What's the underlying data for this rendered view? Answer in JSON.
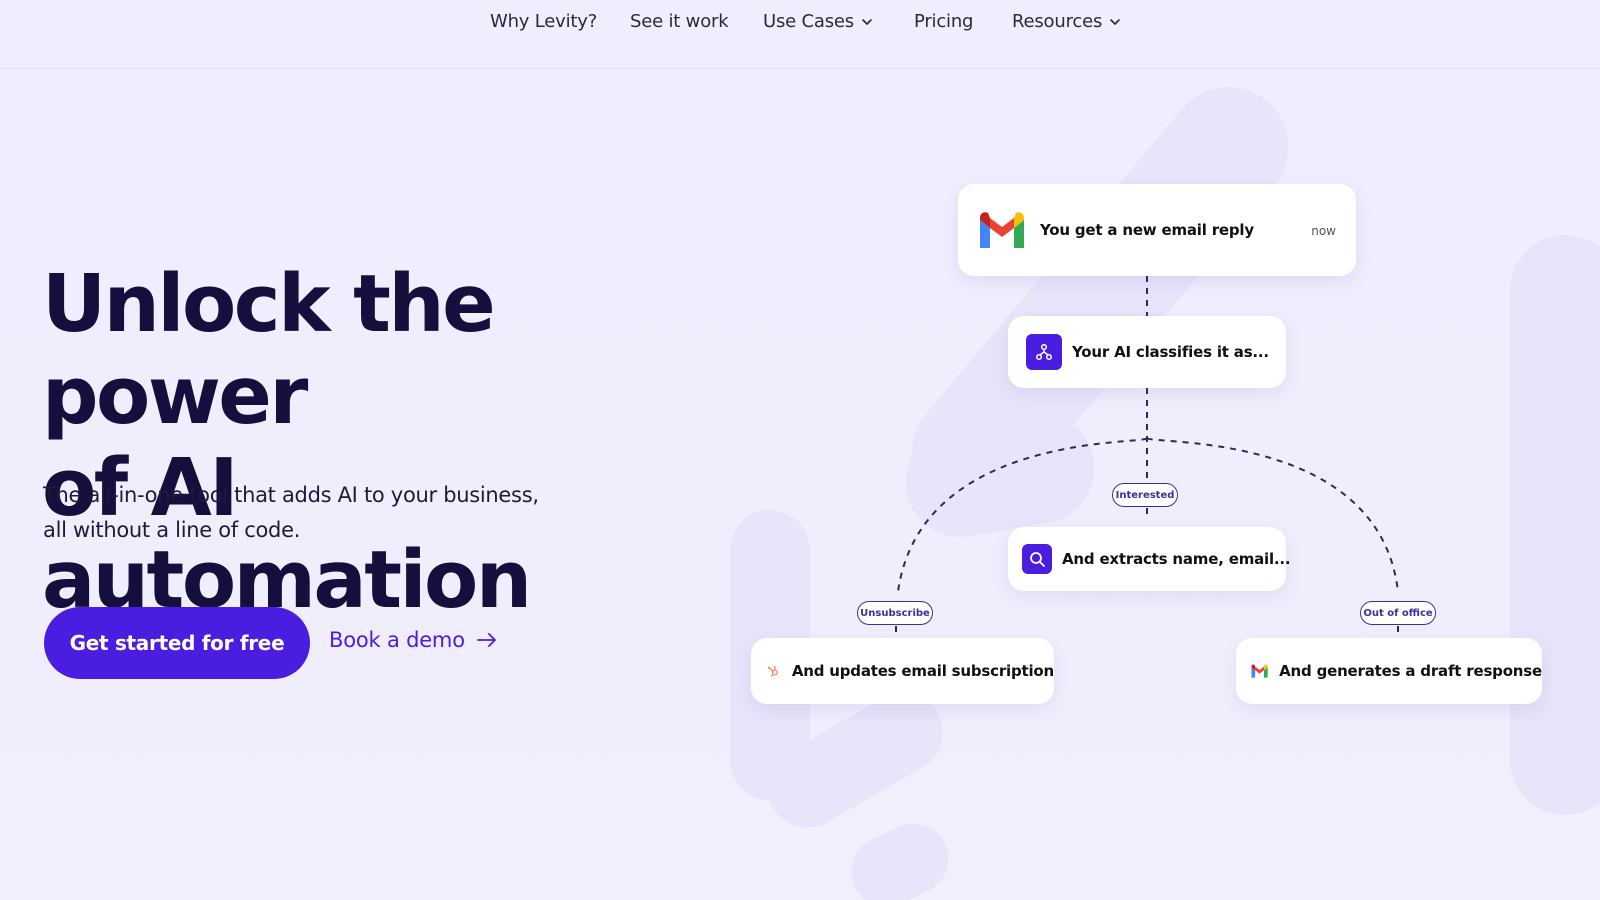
{
  "nav": {
    "items": [
      {
        "label": "Why Levity?",
        "has_dropdown": false
      },
      {
        "label": "See it work",
        "has_dropdown": false
      },
      {
        "label": "Use Cases",
        "has_dropdown": true
      },
      {
        "label": "Pricing",
        "has_dropdown": false
      },
      {
        "label": "Resources",
        "has_dropdown": true
      }
    ]
  },
  "hero": {
    "title_line1": "Unlock the power",
    "title_line2": "of AI automation",
    "subtitle_line1": "The all-in-one tool that adds AI to your business,",
    "subtitle_line2": "all without a line of code.",
    "cta_primary": "Get started for free",
    "cta_secondary": "Book a demo"
  },
  "flow": {
    "trigger": {
      "text": "You get a new email reply",
      "time": "now",
      "icon": "gmail-icon"
    },
    "classify": {
      "text": "Your AI classifies it as...",
      "icon": "classifier-icon"
    },
    "branches": {
      "interested": "Interested",
      "unsubscribe": "Unsubscribe",
      "out_of_office": "Out of office"
    },
    "extract": {
      "text": "And extracts name, email...",
      "icon": "search-icon"
    },
    "update": {
      "text": "And updates email subscription",
      "icon": "hubspot-icon"
    },
    "draft": {
      "text": "And generates a draft response",
      "icon": "gmail-icon"
    }
  },
  "colors": {
    "accent": "#4a1de0",
    "heading": "#140f3c",
    "background": "#eeeefe",
    "hubspot": "#ff7a59"
  }
}
